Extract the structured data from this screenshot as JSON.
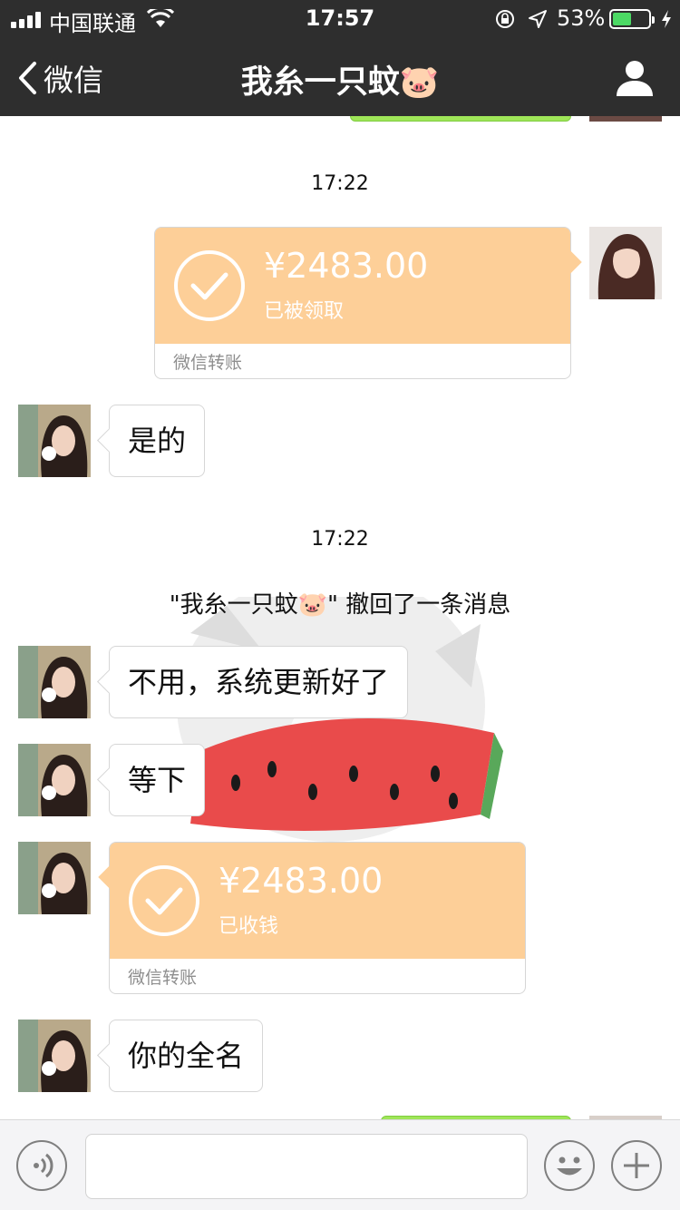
{
  "status_bar": {
    "carrier": "中国联通",
    "time": "17:57",
    "battery_percent": "53%",
    "battery_level": 0.53
  },
  "nav": {
    "back_label": "微信",
    "title": "我糸一只蚊🐷"
  },
  "messages": {
    "ts1": "17:22",
    "transfer_sent": {
      "amount": "¥2483.00",
      "status": "已被领取",
      "label": "微信转账"
    },
    "msg1": "是的",
    "ts2": "17:22",
    "recall_notice": "\"我糸一只蚊🐷\" 撤回了一条消息",
    "msg2": "不用，系统更新好了",
    "msg3": "等下",
    "transfer_received": {
      "amount": "¥2483.00",
      "status": "已收钱",
      "label": "微信转账"
    },
    "msg4": "你的全名"
  },
  "colors": {
    "nav_bg": "#2e2e2e",
    "transfer_bg": "#fdcf98",
    "battery_fill": "#4cd964"
  },
  "icons": {
    "back": "chevron-left-icon",
    "contact": "person-icon",
    "voice": "voice-icon",
    "emoji": "smiley-icon",
    "more": "plus-icon"
  }
}
